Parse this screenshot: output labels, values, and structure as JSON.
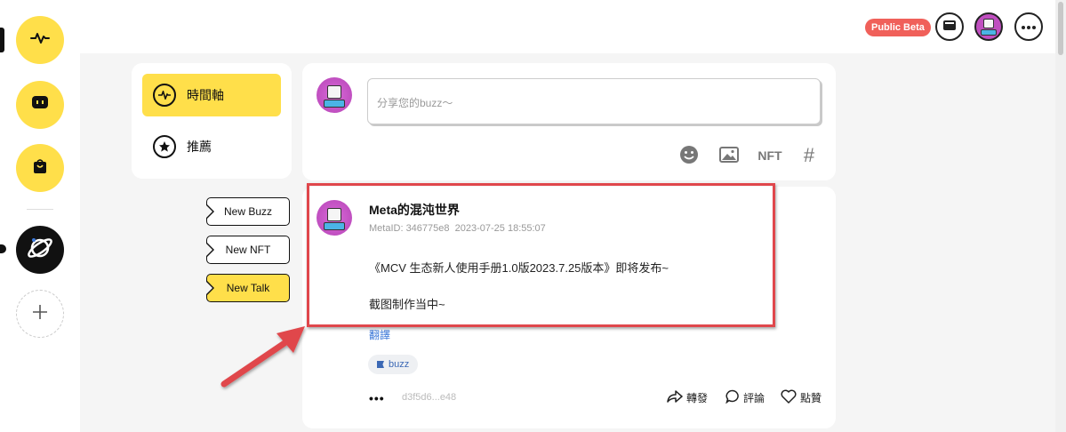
{
  "rail": {
    "items": [
      {
        "name": "activity",
        "icon": "pulse-icon"
      },
      {
        "name": "chat",
        "icon": "chat-icon"
      },
      {
        "name": "shop",
        "icon": "bag-icon"
      },
      {
        "name": "planet",
        "icon": "planet-icon"
      },
      {
        "name": "add",
        "icon": "plus-icon"
      }
    ]
  },
  "topbar": {
    "beta_label": "Public Beta",
    "icons": [
      "wallet-icon",
      "avatar",
      "more-icon"
    ]
  },
  "nav": {
    "items": [
      {
        "label": "時間軸",
        "icon": "timeline-icon",
        "active": true
      },
      {
        "label": "推薦",
        "icon": "star-icon",
        "active": false
      }
    ]
  },
  "tags": [
    "New Buzz",
    "New NFT",
    "New Talk"
  ],
  "composer": {
    "placeholder": "分享您的buzz～",
    "tools": {
      "emoji": "emoji-icon",
      "image": "image-icon",
      "nft_label": "NFT",
      "hashtag": "#"
    }
  },
  "post": {
    "author": "Meta的混沌世界",
    "meta_id": "MetaID: 346775e8",
    "timestamp": "2023-07-25 18:55:07",
    "lines": [
      "《MCV 生态新人使用手册1.0版2023.7.25版本》即将发布~",
      "截图制作当中~"
    ],
    "translate_label": "翻譯",
    "chip_label": "buzz",
    "more_label": "•••",
    "tx_hash": "d3f5d6...e48",
    "actions": {
      "repost": "轉發",
      "comment": "評論",
      "like": "點贊"
    }
  },
  "colors": {
    "accent": "#ffdf4a",
    "beta": "#f0605a",
    "highlight": "#e0474c",
    "link": "#3b78d8"
  }
}
